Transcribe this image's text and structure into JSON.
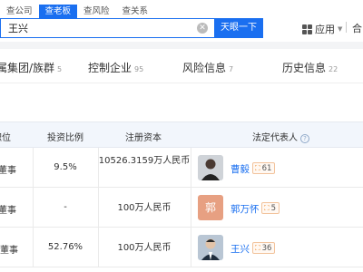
{
  "search": {
    "tabs": [
      "查公司",
      "查老板",
      "查风险",
      "查关系"
    ],
    "active_tab": 1,
    "query": "王兴",
    "button_label": "天眼一下"
  },
  "header": {
    "apps_label": "应用",
    "extra_label": "合"
  },
  "subtabs": [
    {
      "label": "属集团/族群",
      "count": "5"
    },
    {
      "label": "控制企业",
      "count": "95"
    },
    {
      "label": "风险信息",
      "count": "7"
    },
    {
      "label": "历史信息",
      "count": "22"
    }
  ],
  "table": {
    "columns": [
      "职位",
      "投资比例",
      "注册资本",
      "法定代表人"
    ],
    "rows": [
      {
        "position": "董事",
        "ratio": "9.5%",
        "capital": "10526.3159万人民币",
        "rep": "曹毅",
        "avatar": "",
        "badge": "61"
      },
      {
        "position": "董事",
        "ratio": "-",
        "capital": "100万人民币",
        "rep": "郭万怀",
        "avatar": "郭",
        "badge": "5"
      },
      {
        "position": "事董事",
        "ratio": "52.76%",
        "capital": "100万人民币",
        "rep": "王兴",
        "avatar": "",
        "badge": "36"
      }
    ]
  }
}
